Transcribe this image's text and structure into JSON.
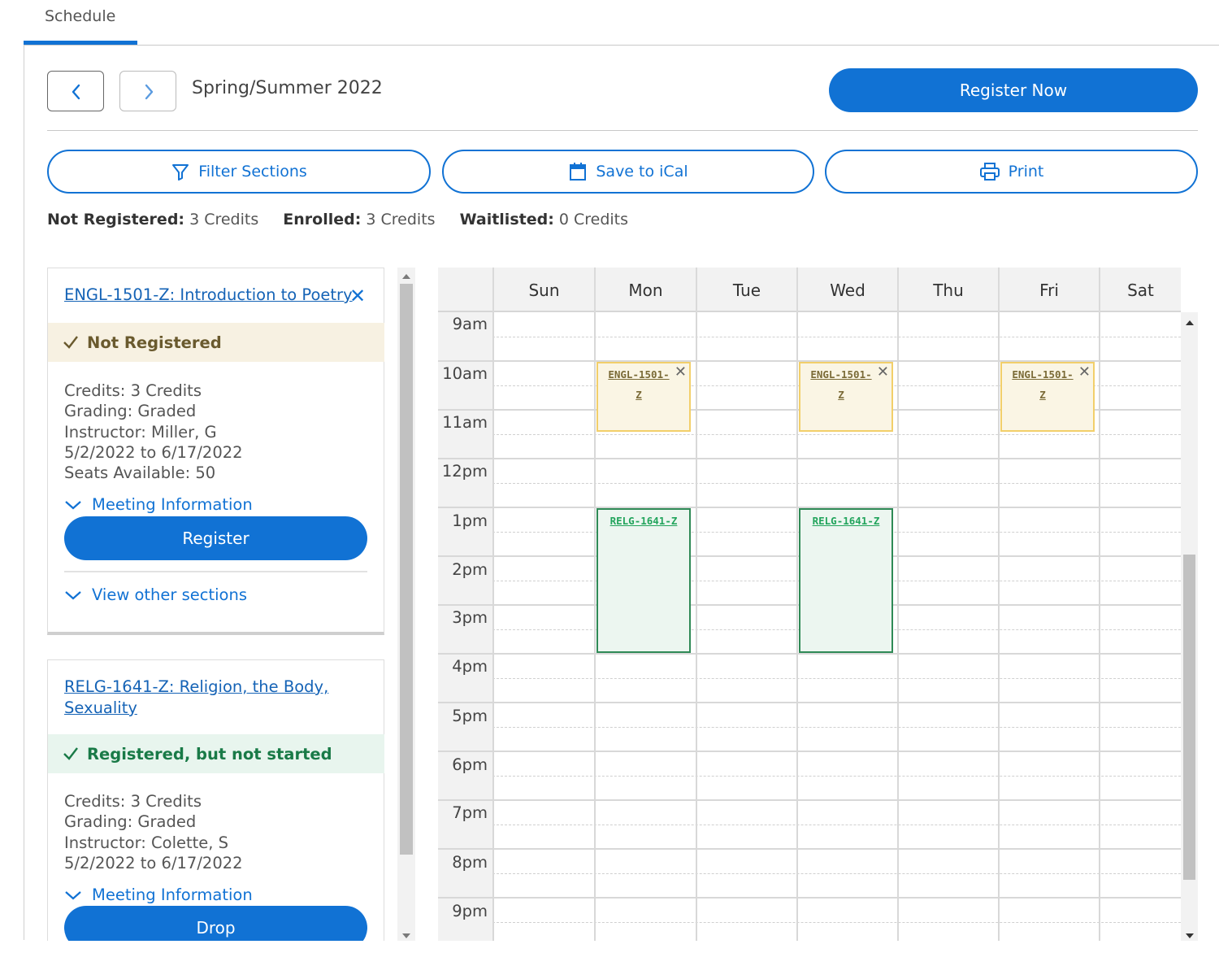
{
  "tabs": {
    "active": "Schedule"
  },
  "term": {
    "label": "Spring/Summer 2022",
    "prev_icon": "chevron-left-icon",
    "next_icon": "chevron-right-icon"
  },
  "actions": {
    "register_now": "Register Now",
    "filter_sections": "Filter Sections",
    "save_to_ical": "Save to iCal",
    "print": "Print"
  },
  "credit_summary": {
    "not_registered_label": "Not Registered:",
    "not_registered_value": "3 Credits",
    "enrolled_label": "Enrolled:",
    "enrolled_value": "3 Credits",
    "waitlisted_label": "Waitlisted:",
    "waitlisted_value": "0 Credits"
  },
  "courses": [
    {
      "title": "ENGL-1501-Z: Introduction to Poetry",
      "status": "Not Registered",
      "credits": "Credits: 3 Credits",
      "grading": "Grading: Graded",
      "instructor": "Instructor: Miller, G",
      "dates": "5/2/2022 to 6/17/2022",
      "seats": "Seats Available:  50",
      "meeting_info": "Meeting Information",
      "action": "Register",
      "other_sections": "View other sections"
    },
    {
      "title_line1": "RELG-1641-Z: Religion, the Body,",
      "title_line2": "Sexuality",
      "status": "Registered, but not started",
      "credits": "Credits: 3 Credits",
      "grading": "Grading: Graded",
      "instructor": "Instructor: Colette, S",
      "dates": "5/2/2022 to 6/17/2022",
      "meeting_info": "Meeting Information",
      "action": "Drop"
    }
  ],
  "calendar": {
    "days": [
      "Sun",
      "Mon",
      "Tue",
      "Wed",
      "Thu",
      "Fri",
      "Sat"
    ],
    "times": [
      "9am",
      "10am",
      "11am",
      "12pm",
      "1pm",
      "2pm",
      "3pm",
      "4pm",
      "5pm",
      "6pm",
      "7pm",
      "8pm",
      "9pm"
    ],
    "events": {
      "engl_line1": "ENGL-1501-",
      "engl_line2": "Z",
      "relg": "RELG-1641-Z"
    }
  },
  "colors": {
    "accent": "#1172d4",
    "not_registered_bg": "#f7f1e2",
    "registered_bg": "#e8f5ee",
    "engl_border": "#f2cf6a",
    "relg_border": "#2f8a56"
  }
}
